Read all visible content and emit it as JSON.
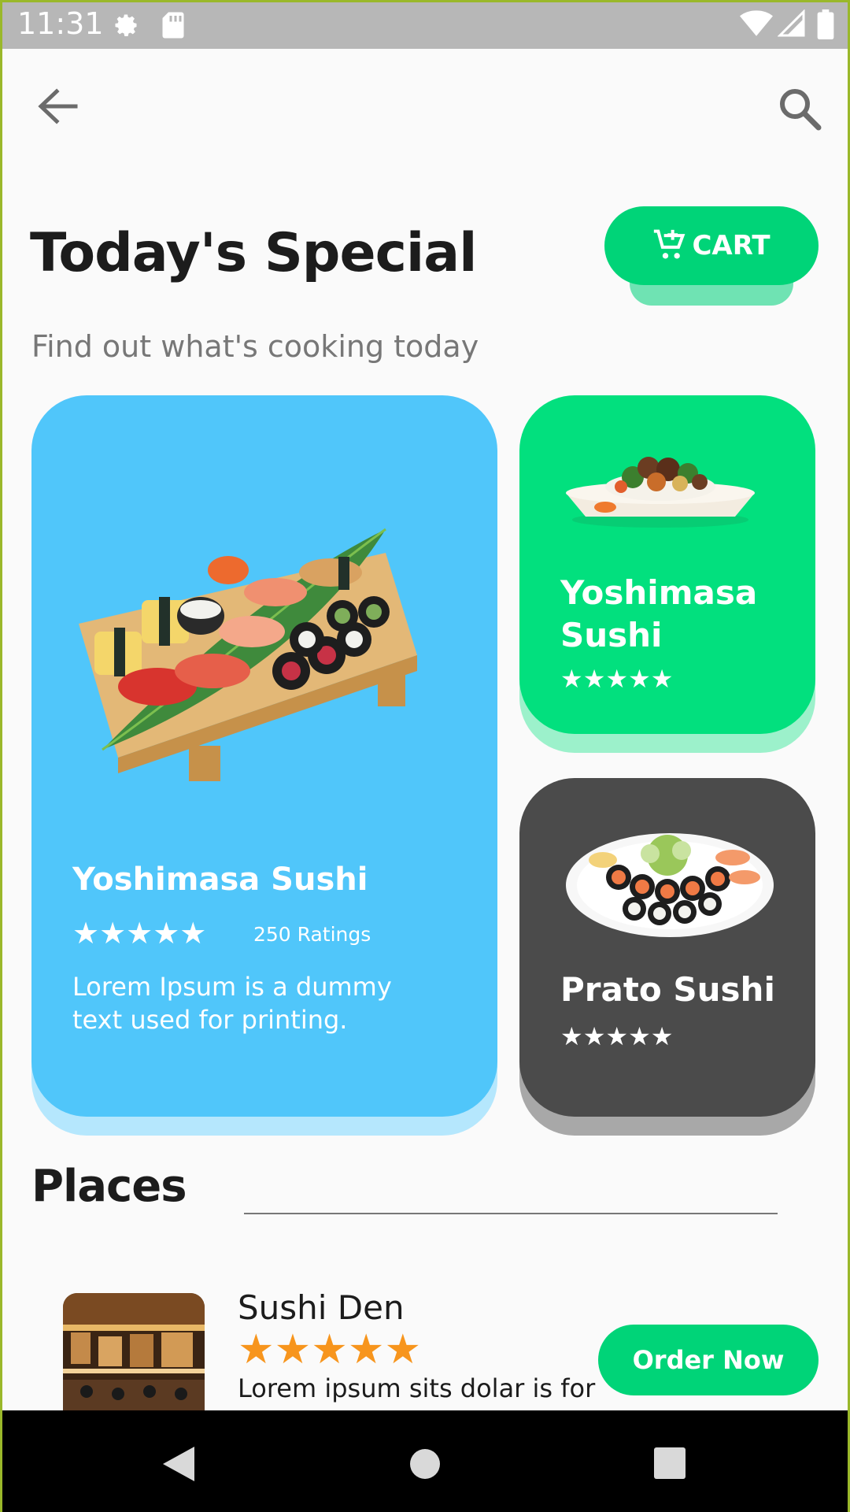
{
  "status_bar": {
    "time": "11:31",
    "icons": [
      "gear-icon",
      "sd-card-icon",
      "wifi-icon",
      "signal-icon",
      "battery-icon"
    ]
  },
  "header": {
    "back_icon": "back-arrow-icon",
    "search_icon": "search-icon",
    "title": "Today's Special",
    "subtitle": "Find out what's cooking today",
    "cart_label": "CART"
  },
  "specials": [
    {
      "name": "Yoshimasa Sushi",
      "stars": "★★★★★",
      "ratings": "250 Ratings",
      "description": "Lorem Ipsum is a dummy text used for printing.",
      "color": "#50c6fa"
    },
    {
      "name": "Yoshimasa Sushi",
      "stars": "★★★★★",
      "color": "#02e07e"
    },
    {
      "name": "Prato Sushi",
      "stars": "★★★★★",
      "color": "#4b4b4b"
    }
  ],
  "places": {
    "title": "Places",
    "items": [
      {
        "name": "Sushi Den",
        "stars": "★★★★★",
        "description": "Lorem ipsum sits dolar is for",
        "button_label": "Order Now"
      }
    ]
  },
  "colors": {
    "accent_green": "#00d478",
    "star_orange": "#f7951d"
  },
  "nav_bar": {
    "icons": [
      "nav-back-icon",
      "nav-home-icon",
      "nav-recents-icon"
    ]
  }
}
